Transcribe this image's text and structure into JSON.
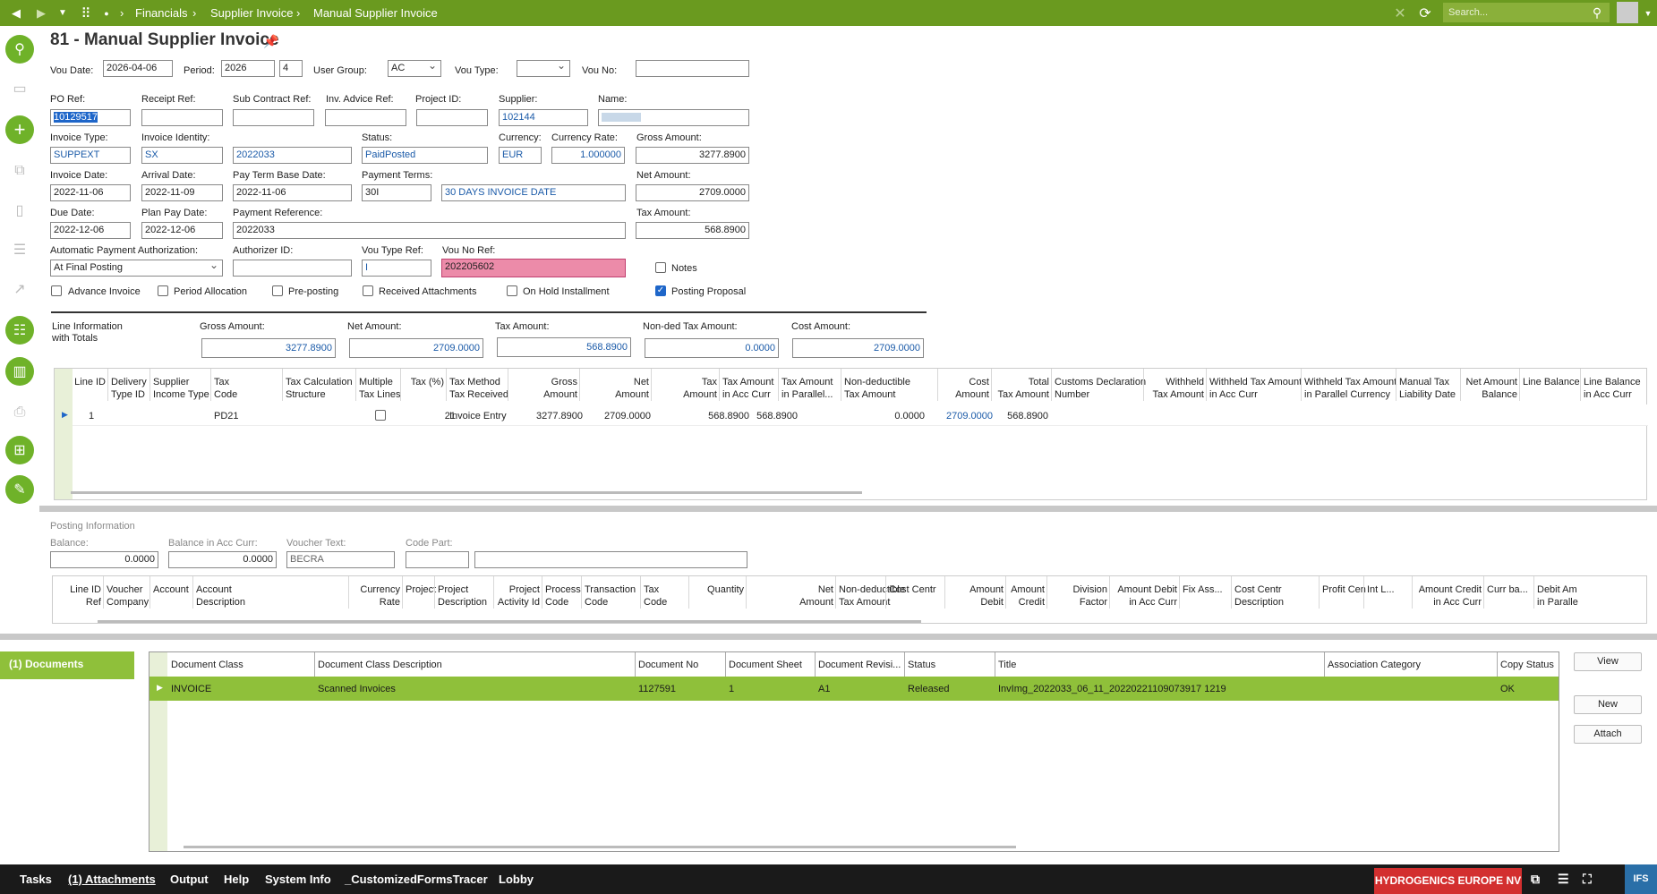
{
  "topbar": {
    "crumbs": [
      "Financials",
      "Supplier Invoice",
      "Manual Supplier Invoice"
    ],
    "search_placeholder": "Search..."
  },
  "page": {
    "title": "81 - Manual Supplier Invoice"
  },
  "header": {
    "vou_date_label": "Vou Date:",
    "vou_date": "2026-04-06",
    "period_label": "Period:",
    "period_year": "2026",
    "period_month": "4",
    "user_group_label": "User Group:",
    "user_group": "AC",
    "vou_type_label": "Vou Type:",
    "vou_type": "",
    "vou_no_label": "Vou No:",
    "vou_no": ""
  },
  "form": {
    "po_ref_label": "PO Ref:",
    "po_ref": "10129517",
    "receipt_ref_label": "Receipt Ref:",
    "receipt_ref": "",
    "sub_contract_label": "Sub Contract Ref:",
    "sub_contract": "",
    "inv_advice_label": "Inv. Advice Ref:",
    "inv_advice": "",
    "project_id_label": "Project ID:",
    "project_id": "",
    "supplier_label": "Supplier:",
    "supplier": "102144",
    "name_label": "Name:",
    "name": "",
    "invoice_type_label": "Invoice Type:",
    "invoice_type": "SUPPEXT",
    "invoice_identity_label": "Invoice Identity:",
    "invoice_identity": "SX",
    "invoice_identity2": "2022033",
    "status_label": "Status:",
    "status": "PaidPosted",
    "currency_label": "Currency:",
    "currency": "EUR",
    "currency_rate_label": "Currency Rate:",
    "currency_rate": "1.000000",
    "gross_amount_label": "Gross Amount:",
    "gross_amount": "3277.8900",
    "invoice_date_label": "Invoice Date:",
    "invoice_date": "2022-11-06",
    "arrival_date_label": "Arrival Date:",
    "arrival_date": "2022-11-09",
    "pay_term_label": "Pay Term Base Date:",
    "pay_term": "2022-11-06",
    "payment_terms_label": "Payment Terms:",
    "payment_terms": "30I",
    "payment_terms_desc": "30 DAYS INVOICE DATE",
    "net_amount_label": "Net Amount:",
    "net_amount": "2709.0000",
    "due_date_label": "Due Date:",
    "due_date": "2022-12-06",
    "plan_pay_label": "Plan Pay Date:",
    "plan_pay": "2022-12-06",
    "payment_ref_label": "Payment Reference:",
    "payment_ref": "2022033",
    "tax_amount_label": "Tax Amount:",
    "tax_amount": "568.8900",
    "auto_pay_label": "Automatic Payment Authorization:",
    "auto_pay": "At Final Posting",
    "authorizer_label": "Authorizer ID:",
    "authorizer": "",
    "vou_type_ref_label": "Vou Type Ref:",
    "vou_type_ref": "I",
    "vou_no_ref_label": "Vou No Ref:",
    "vou_no_ref": "202205602",
    "notes_label": "Notes",
    "advance_label": "Advance Invoice",
    "period_alloc_label": "Period Allocation",
    "preposting_label": "Pre-posting",
    "received_att_label": "Received Attachments",
    "on_hold_label": "On Hold Installment",
    "posting_proposal_label": "Posting Proposal"
  },
  "totals": {
    "title1": "Line Information",
    "title2": "with Totals",
    "gross_label": "Gross Amount:",
    "gross": "3277.8900",
    "net_label": "Net Amount:",
    "net": "2709.0000",
    "tax_label": "Tax Amount:",
    "tax": "568.8900",
    "nonded_label": "Non-ded Tax Amount:",
    "nonded": "0.0000",
    "cost_label": "Cost Amount:",
    "cost": "2709.0000"
  },
  "lines": {
    "headers": [
      [
        "Line ID",
        ""
      ],
      [
        "Delivery",
        "Type ID"
      ],
      [
        "Supplier",
        "Income Type"
      ],
      [
        "Tax",
        "Code"
      ],
      [
        "Tax Calculation",
        "Structure"
      ],
      [
        "Multiple",
        "Tax Lines"
      ],
      [
        "Tax (%)",
        ""
      ],
      [
        "Tax Method",
        "Tax Received"
      ],
      [
        "Gross",
        "Amount"
      ],
      [
        "Net",
        "Amount"
      ],
      [
        "Tax",
        "Amount"
      ],
      [
        "Tax Amount",
        "in Acc Curr"
      ],
      [
        "Tax Amount",
        "in Parallel..."
      ],
      [
        "Non-deductible",
        "Tax Amount"
      ],
      [
        "Cost",
        "Amount"
      ],
      [
        "Total",
        "Tax Amount"
      ],
      [
        "Customs Declaration",
        "Number"
      ],
      [
        "Withheld",
        "Tax Amount"
      ],
      [
        "Withheld Tax Amount",
        "in Acc Curr"
      ],
      [
        "Withheld Tax Amount",
        "in Parallel Currency"
      ],
      [
        "Manual Tax",
        "Liability Date"
      ],
      [
        "Net Amount",
        "Balance"
      ],
      [
        "Line Balance",
        ""
      ],
      [
        "Line Balance",
        "in Acc Curr"
      ]
    ],
    "row": {
      "line_id": "1",
      "tax_code": "PD21",
      "tax_pct": "21",
      "tax_method": "Invoice Entry",
      "gross": "3277.8900",
      "net": "2709.0000",
      "tax": "568.8900",
      "tax_acc": "568.8900",
      "nonded": "0.0000",
      "cost": "2709.0000",
      "total_tax": "568.8900"
    }
  },
  "posting": {
    "title": "Posting Information",
    "balance_label": "Balance:",
    "balance": "0.0000",
    "balance_acc_label": "Balance in Acc Curr:",
    "balance_acc": "0.0000",
    "voucher_text_label": "Voucher Text:",
    "voucher_text": "BECRA",
    "code_part_label": "Code Part:",
    "code_part": "",
    "code_part_desc": "",
    "headers": [
      [
        "Line ID",
        "Ref"
      ],
      [
        "Voucher",
        "Company"
      ],
      [
        "Account",
        ""
      ],
      [
        "Account",
        "Description"
      ],
      [
        "Currency",
        "Rate"
      ],
      [
        "Project",
        ""
      ],
      [
        "Project",
        "Description"
      ],
      [
        "Project",
        "Activity Id"
      ],
      [
        "Process",
        "Code"
      ],
      [
        "Transaction",
        "Code"
      ],
      [
        "Tax",
        "Code"
      ],
      [
        "Quantity",
        ""
      ],
      [
        "Net",
        "Amount"
      ],
      [
        "Non-deductible",
        "Tax Amount"
      ],
      [
        "Cost Centr",
        ""
      ],
      [
        "Amount",
        "Debit"
      ],
      [
        "Amount",
        "Credit"
      ],
      [
        "Division",
        "Factor"
      ],
      [
        "Amount Debit",
        "in Acc Curr"
      ],
      [
        "Fix Ass...",
        ""
      ],
      [
        "Cost Centr",
        "Description"
      ],
      [
        "Profit Cen",
        ""
      ],
      [
        "Int L...",
        ""
      ],
      [
        "Amount Credit",
        "in Acc Curr"
      ],
      [
        "Curr ba...",
        ""
      ],
      [
        "Debit Am",
        "in Paralle"
      ]
    ]
  },
  "documents": {
    "tab_label": "(1) Documents",
    "headers": [
      "Document Class",
      "Document Class Description",
      "Document No",
      "Document Sheet",
      "Document Revisi...",
      "Status",
      "Title",
      "Association Category",
      "Copy Status"
    ],
    "row": [
      "INVOICE",
      "Scanned Invoices",
      "1127591",
      "1",
      "A1",
      "Released",
      "InvImg_2022033_06_11_20220221109073917 1219",
      "",
      "OK"
    ],
    "view_label": "View",
    "new_label": "New",
    "attach_label": "Attach"
  },
  "bottombar": {
    "tasks": "Tasks",
    "attachments": "(1) Attachments",
    "output": "Output",
    "help": "Help",
    "sysinfo": "System Info",
    "customized": "_CustomizedFormsTracer",
    "lobby": "Lobby",
    "company": "HYDROGENICS EUROPE NV"
  },
  "colors": {
    "brand": "#6a9a1f",
    "accent": "#6fb229",
    "row_selected": "#8fc03a",
    "error": "#ec8ba9",
    "company_badge": "#d32f2f"
  }
}
